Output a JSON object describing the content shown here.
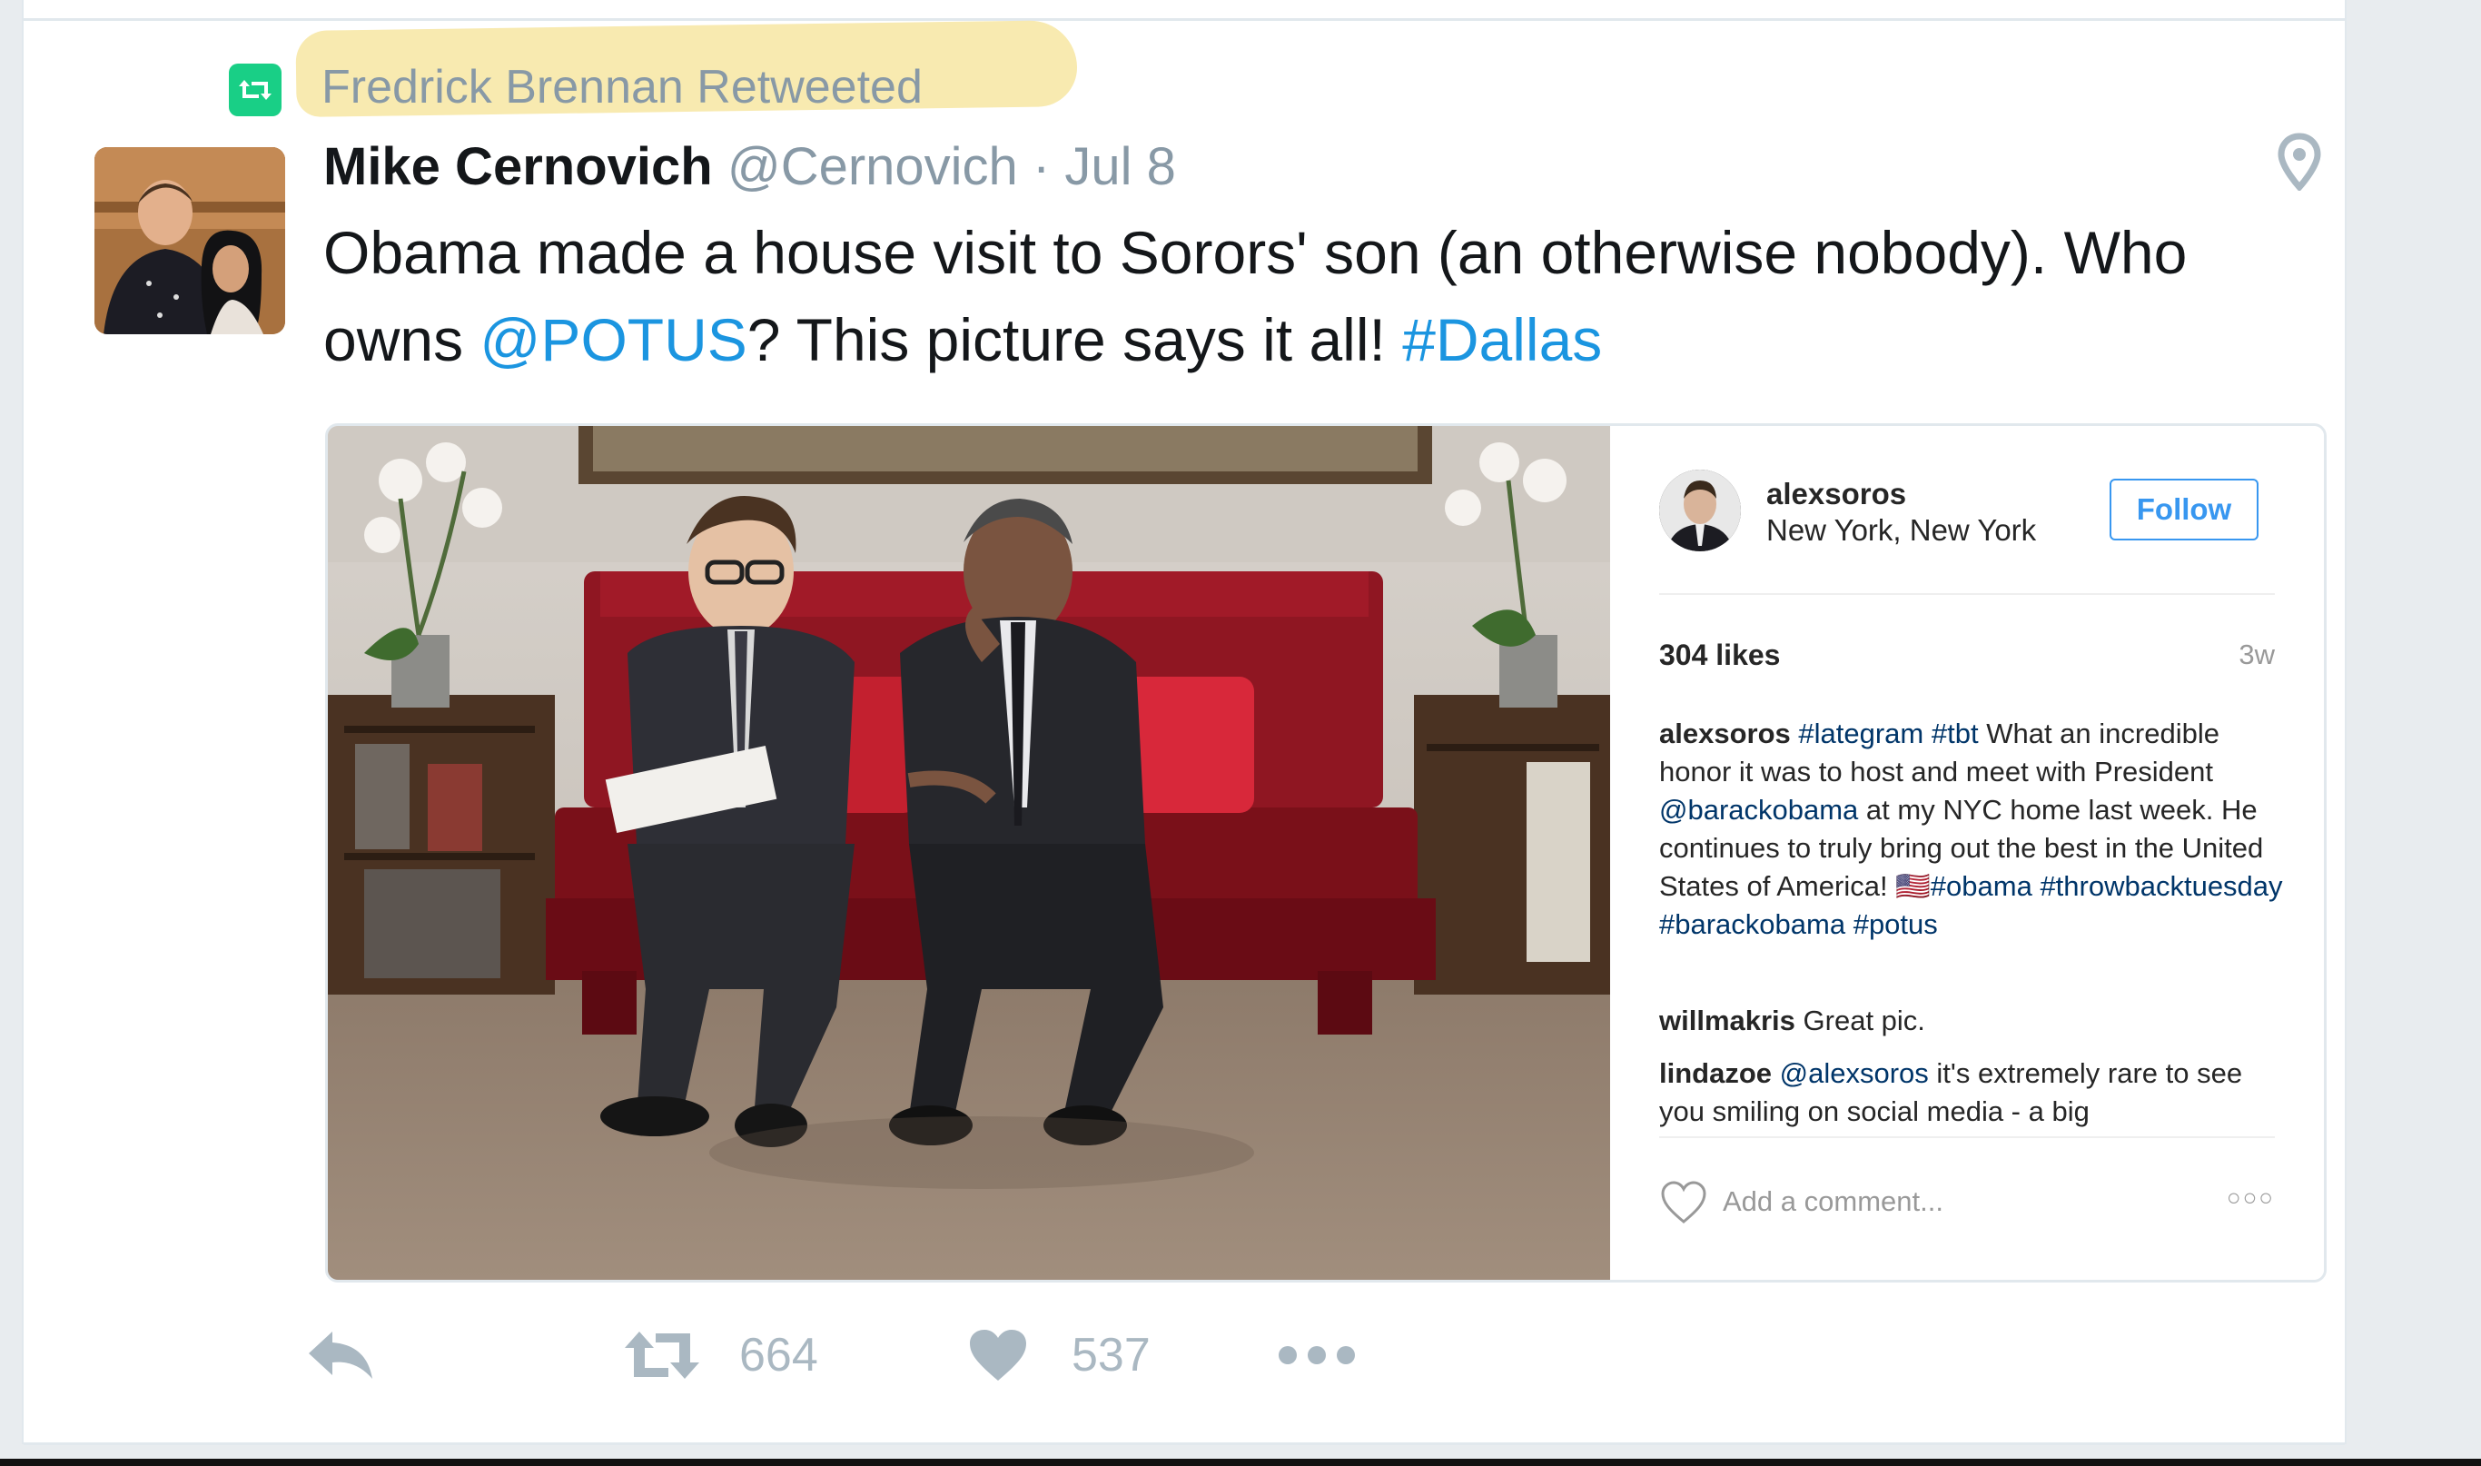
{
  "retweet_context": {
    "text": "Fredrick Brennan Retweeted"
  },
  "tweet": {
    "display_name": "Mike Cernovich",
    "handle": "@Cernovich",
    "separator": "·",
    "date": "Jul 8",
    "text_parts": {
      "p1": "Obama made a house visit to Sorors' son (an otherwise nobody). Who owns ",
      "mention": "@POTUS",
      "p2": "? This picture says it all! ",
      "hashtag": "#Dallas"
    }
  },
  "instagram": {
    "username": "alexsoros",
    "location": "New York, New York",
    "follow_label": "Follow",
    "likes": "304 likes",
    "time": "3w",
    "caption": {
      "user": "alexsoros",
      "t1": "#lategram",
      "t2": "#tbt",
      "s1": " What an incredible honor it was to host and meet with President ",
      "t3": "@barackobama",
      "s2": " at my NYC home last week. He continues to truly bring out the best in the United States of America! ",
      "flag": "🇺🇸",
      "t4": "#obama",
      "t5": "#throwbacktuesday",
      "t6": "#barackobama",
      "t7": "#potus"
    },
    "comments": [
      {
        "user": "willmakris",
        "text": " Great pic."
      },
      {
        "user": "lindazoe",
        "mention": "@alexsoros",
        "text": " it's extremely rare to see you smiling on social media - a big"
      }
    ],
    "add_comment_placeholder": "Add a comment...",
    "more_label": "○○○"
  },
  "actions": {
    "retweets": "664",
    "likes": "537"
  },
  "icons": {
    "retweet": "retweet-icon",
    "location": "location-pin-icon",
    "reply": "reply-icon",
    "like": "heart-icon",
    "more": "more-icon"
  },
  "colors": {
    "retweet_green": "#19cf86",
    "link_blue": "#1b95e0",
    "muted": "#8899a6",
    "ig_blue": "#3897f0",
    "highlight": "#f8eab0"
  }
}
